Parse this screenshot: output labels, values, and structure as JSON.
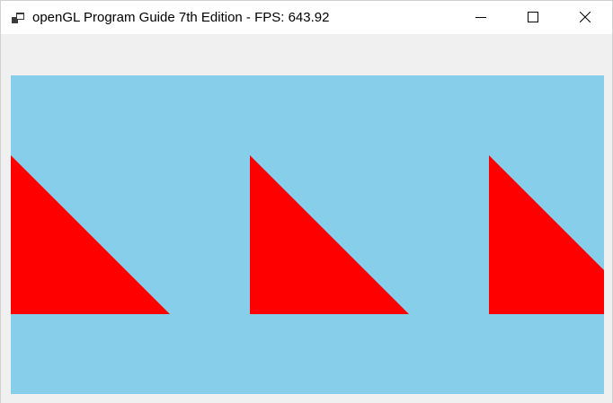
{
  "window": {
    "title": "openGL Program Guide 7th Edition - FPS: 643.92",
    "icon": "app-window-icon",
    "controls": {
      "minimize_icon": "minimize-icon",
      "maximize_icon": "maximize-icon",
      "close_icon": "close-icon"
    }
  },
  "viewport": {
    "background_color": "#87ceeb",
    "shape_color": "#ff0000",
    "shape_icon": "red-triangle",
    "triangle_count": 3
  }
}
